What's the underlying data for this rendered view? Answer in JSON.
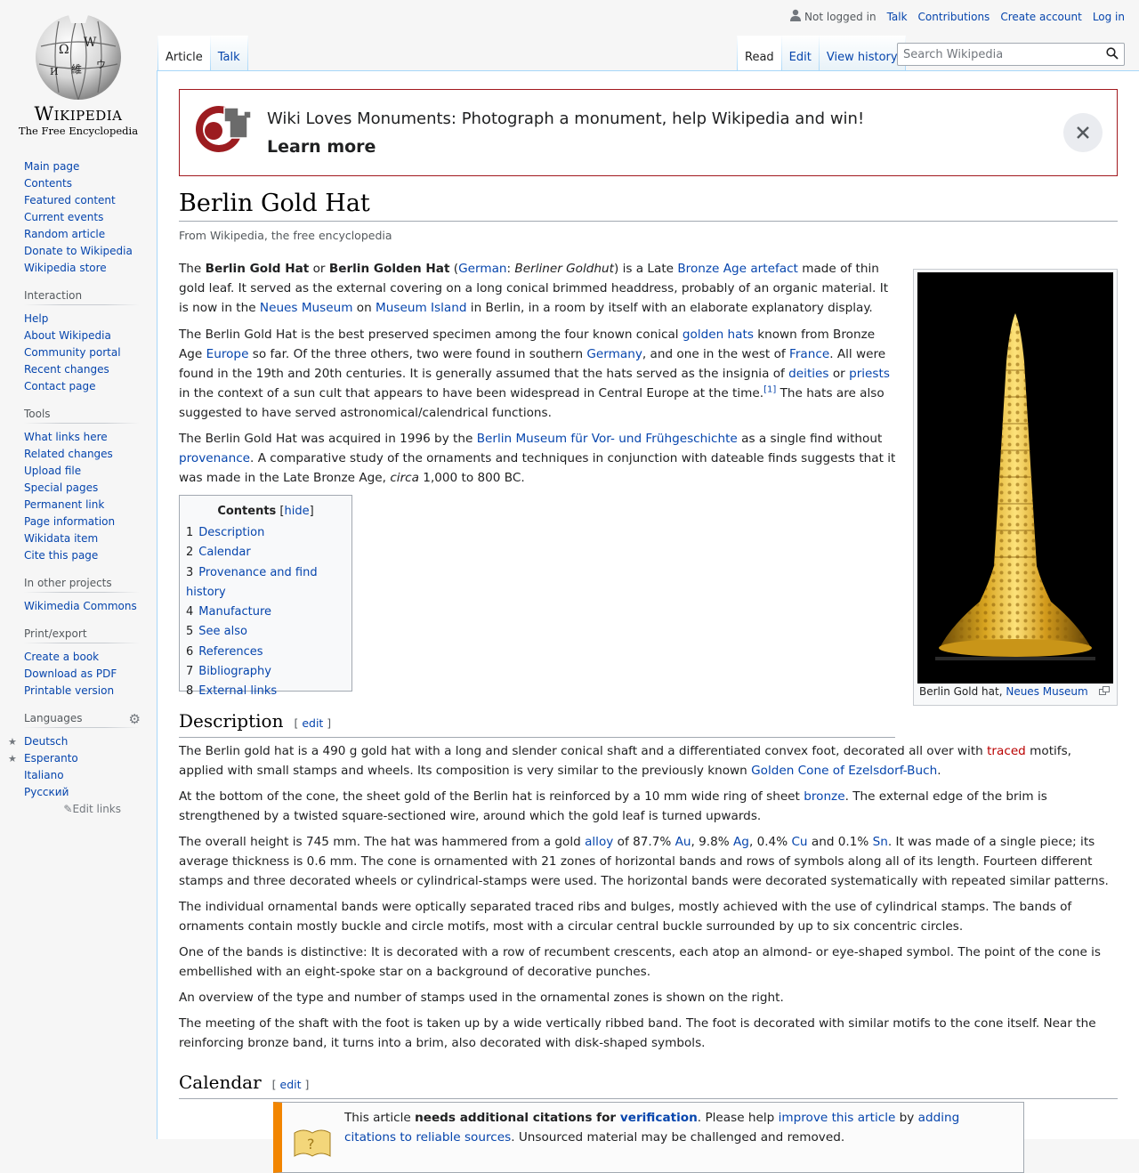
{
  "logo": {
    "wordmark": "Wikipedia",
    "tagline": "The Free Encyclopedia"
  },
  "personal": {
    "not_logged_in": "Not logged in",
    "talk": "Talk",
    "contributions": "Contributions",
    "create_account": "Create account",
    "log_in": "Log in"
  },
  "tabs": {
    "left": [
      {
        "label": "Article",
        "selected": true
      },
      {
        "label": "Talk",
        "selected": false
      }
    ],
    "right": [
      {
        "label": "Read",
        "selected": true
      },
      {
        "label": "Edit",
        "selected": false
      },
      {
        "label": "View history",
        "selected": false
      }
    ]
  },
  "search": {
    "placeholder": "Search Wikipedia",
    "value": ""
  },
  "sidebar": {
    "navigation": [
      "Main page",
      "Contents",
      "Featured content",
      "Current events",
      "Random article",
      "Donate to Wikipedia",
      "Wikipedia store"
    ],
    "interaction": {
      "heading": "Interaction",
      "items": [
        "Help",
        "About Wikipedia",
        "Community portal",
        "Recent changes",
        "Contact page"
      ]
    },
    "tools": {
      "heading": "Tools",
      "items": [
        "What links here",
        "Related changes",
        "Upload file",
        "Special pages",
        "Permanent link",
        "Page information",
        "Wikidata item",
        "Cite this page"
      ]
    },
    "other_projects": {
      "heading": "In other projects",
      "items": [
        "Wikimedia Commons"
      ]
    },
    "print_export": {
      "heading": "Print/export",
      "items": [
        "Create a book",
        "Download as PDF",
        "Printable version"
      ]
    },
    "languages": {
      "heading": "Languages",
      "items": [
        {
          "label": "Deutsch",
          "featured": true
        },
        {
          "label": "Esperanto",
          "featured": true
        },
        {
          "label": "Italiano",
          "featured": false
        },
        {
          "label": "Русский",
          "featured": false
        }
      ],
      "edit_links": "Edit links"
    }
  },
  "banner": {
    "text": "Wiki Loves Monuments: Photograph a monument, help Wikipedia and win!",
    "learn_more": "Learn more"
  },
  "article": {
    "title": "Berlin Gold Hat",
    "tagline": "From Wikipedia, the free encyclopedia",
    "intro": {
      "p1": {
        "t1": "The ",
        "b1": "Berlin Gold Hat",
        "t2": " or ",
        "b2": "Berlin Golden Hat",
        "t3": " (",
        "l_german": "German",
        "t4": ": ",
        "i_goldhut": "Berliner Goldhut",
        "t5": ") is a Late ",
        "l_bronze_age": "Bronze Age",
        "t6": " ",
        "l_artefact": "artefact",
        "t7": " made of thin gold leaf. It served as the external covering on a long conical brimmed headdress, probably of an organic material. It is now in the ",
        "l_neues": "Neues Museum",
        "t8": " on ",
        "l_island": "Museum Island",
        "t9": " in Berlin, in a room by itself with an elaborate explanatory display."
      },
      "p2": {
        "t1": "The Berlin Gold Hat is the best preserved specimen among the four known conical ",
        "l_golden_hats": "golden hats",
        "t2": " known from Bronze Age ",
        "l_europe": "Europe",
        "t3": " so far. Of the three others, two were found in southern ",
        "l_germany": "Germany",
        "t4": ", and one in the west of ",
        "l_france": "France",
        "t5": ". All were found in the 19th and 20th centuries. It is generally assumed that the hats served as the insignia of ",
        "l_deities": "deities",
        "t6": " or ",
        "l_priests": "priests",
        "t7": " in the context of a sun cult that appears to have been widespread in Central Europe at the time.",
        "ref": "[1]",
        "t8": " The hats are also suggested to have served astronomical/calendrical functions."
      },
      "p3": {
        "t1": "The Berlin Gold Hat was acquired in 1996 by the ",
        "l_museum": "Berlin Museum für Vor- und Frühgeschichte",
        "t2": " as a single find without ",
        "l_provenance": "provenance",
        "t3": ". A comparative study of the ornaments and techniques in conjunction with dateable finds suggests that it was made in the Late Bronze Age, ",
        "i_circa": "circa",
        "t4": " 1,000 to 800 BC."
      }
    },
    "figure": {
      "caption": "Berlin Gold hat, ",
      "caption_link": "Neues Museum"
    },
    "toc": {
      "title": "Contents",
      "hide": "hide",
      "items": [
        {
          "num": "1",
          "label": "Description"
        },
        {
          "num": "2",
          "label": "Calendar"
        },
        {
          "num": "3",
          "label": "Provenance and find history"
        },
        {
          "num": "4",
          "label": "Manufacture"
        },
        {
          "num": "5",
          "label": "See also"
        },
        {
          "num": "6",
          "label": "References"
        },
        {
          "num": "7",
          "label": "Bibliography"
        },
        {
          "num": "8",
          "label": "External links"
        }
      ]
    },
    "edit_label": "edit",
    "description": {
      "heading": "Description",
      "p1": {
        "t1": "The Berlin gold hat is a 490 g gold hat with a long and slender conical shaft and a differentiated convex foot, decorated all over with ",
        "l_traced": "traced",
        "t2": " motifs, applied with small stamps and wheels. Its composition is very similar to the previously known ",
        "l_ezelsdorf": "Golden Cone of Ezelsdorf-Buch",
        "t3": "."
      },
      "p2": {
        "t1": "At the bottom of the cone, the sheet gold of the Berlin hat is reinforced by a 10 mm wide ring of sheet ",
        "l_bronze": "bronze",
        "t2": ". The external edge of the brim is strengthened by a twisted square-sectioned wire, around which the gold leaf is turned upwards."
      },
      "p3": {
        "t1": "The overall height is 745 mm. The hat was hammered from a gold ",
        "l_alloy": "alloy",
        "t2": " of 87.7% ",
        "l_au": "Au",
        "t3": ", 9.8% ",
        "l_ag": "Ag",
        "t4": ", 0.4% ",
        "l_cu": "Cu",
        "t5": " and 0.1% ",
        "l_sn": "Sn",
        "t6": ". It was made of a single piece; its average thickness is 0.6 mm. The cone is ornamented with 21 zones of horizontal bands and rows of symbols along all of its length. Fourteen different stamps and three decorated wheels or cylindrical-stamps were used. The horizontal bands were decorated systematically with repeated similar patterns."
      },
      "p4": "The individual ornamental bands were optically separated traced ribs and bulges, mostly achieved with the use of cylindrical stamps. The bands of ornaments contain mostly buckle and circle motifs, most with a circular central buckle surrounded by up to six concentric circles.",
      "p5": "One of the bands is distinctive: It is decorated with a row of recumbent crescents, each atop an almond- or eye-shaped symbol. The point of the cone is embellished with an eight-spoke star on a background of decorative punches.",
      "p6": "An overview of the type and number of stamps used in the ornamental zones is shown on the right.",
      "p7": "The meeting of the shaft with the foot is taken up by a wide vertically ribbed band. The foot is decorated with similar motifs to the cone itself. Near the reinforcing bronze band, it turns into a brim, also decorated with disk-shaped symbols."
    },
    "calendar": {
      "heading": "Calendar"
    },
    "ambox": {
      "t1": "This article ",
      "b1": "needs additional citations for ",
      "l_verification": "verification",
      "t2": ". Please help ",
      "l_improve": "improve this article",
      "t3": " by ",
      "l_adding": "adding citations to reliable sources",
      "t4": ". Unsourced material may be challenged and removed."
    }
  },
  "colors": {
    "link": "#0645ad",
    "redlink": "#ba0000",
    "banner_border": "#a2181e",
    "ambox_accent": "#f28500"
  }
}
